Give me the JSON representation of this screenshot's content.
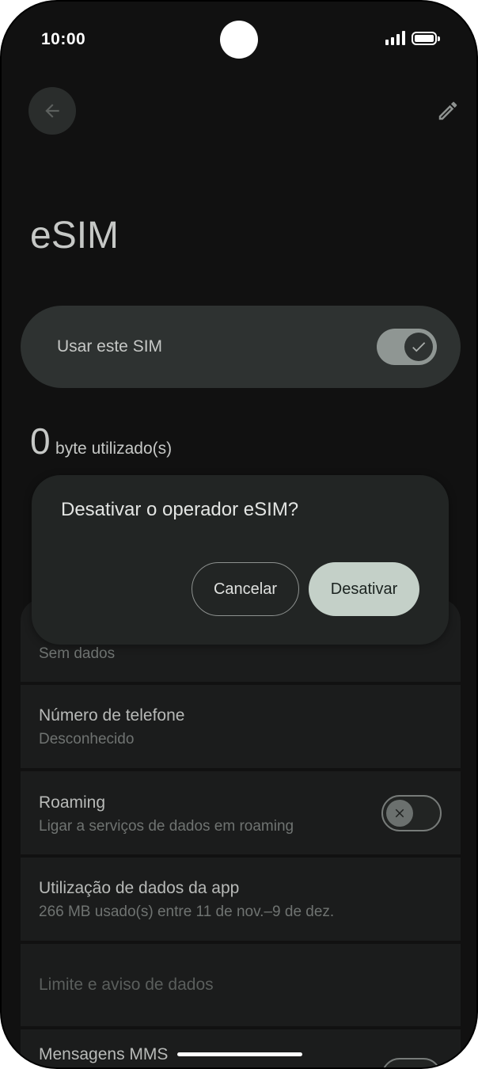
{
  "status_bar": {
    "time": "10:00",
    "icons": [
      "signal-icon",
      "battery-icon"
    ]
  },
  "header": {
    "back_icon": "arrow-left-icon",
    "edit_icon": "pencil-icon",
    "title": "eSIM"
  },
  "sim_toggle": {
    "label": "Usar este SIM",
    "checked": true
  },
  "usage": {
    "amount": "0",
    "unit": "byte utilizado(s)"
  },
  "settings": {
    "items": [
      {
        "title": "",
        "subtitle": "Sem dados"
      },
      {
        "title": "Número de telefone",
        "subtitle": "Desconhecido"
      },
      {
        "title": "Roaming",
        "subtitle": "Ligar a serviços de dados em roaming",
        "toggle_checked": false
      },
      {
        "title": "Utilização de dados da app",
        "subtitle": "266 MB usado(s) entre 11 de nov.–9 de dez."
      },
      {
        "title": "Limite e aviso de dados",
        "subtitle": ""
      },
      {
        "title": "Mensagens MMS",
        "subtitle": ""
      }
    ]
  },
  "dialog": {
    "title": "Desativar o operador eSIM?",
    "cancel_label": "Cancelar",
    "confirm_label": "Desativar"
  },
  "colors": {
    "background": "#111111",
    "card": "#2e3231",
    "dialog": "#222524",
    "primary_button": "#c4d0c8"
  }
}
